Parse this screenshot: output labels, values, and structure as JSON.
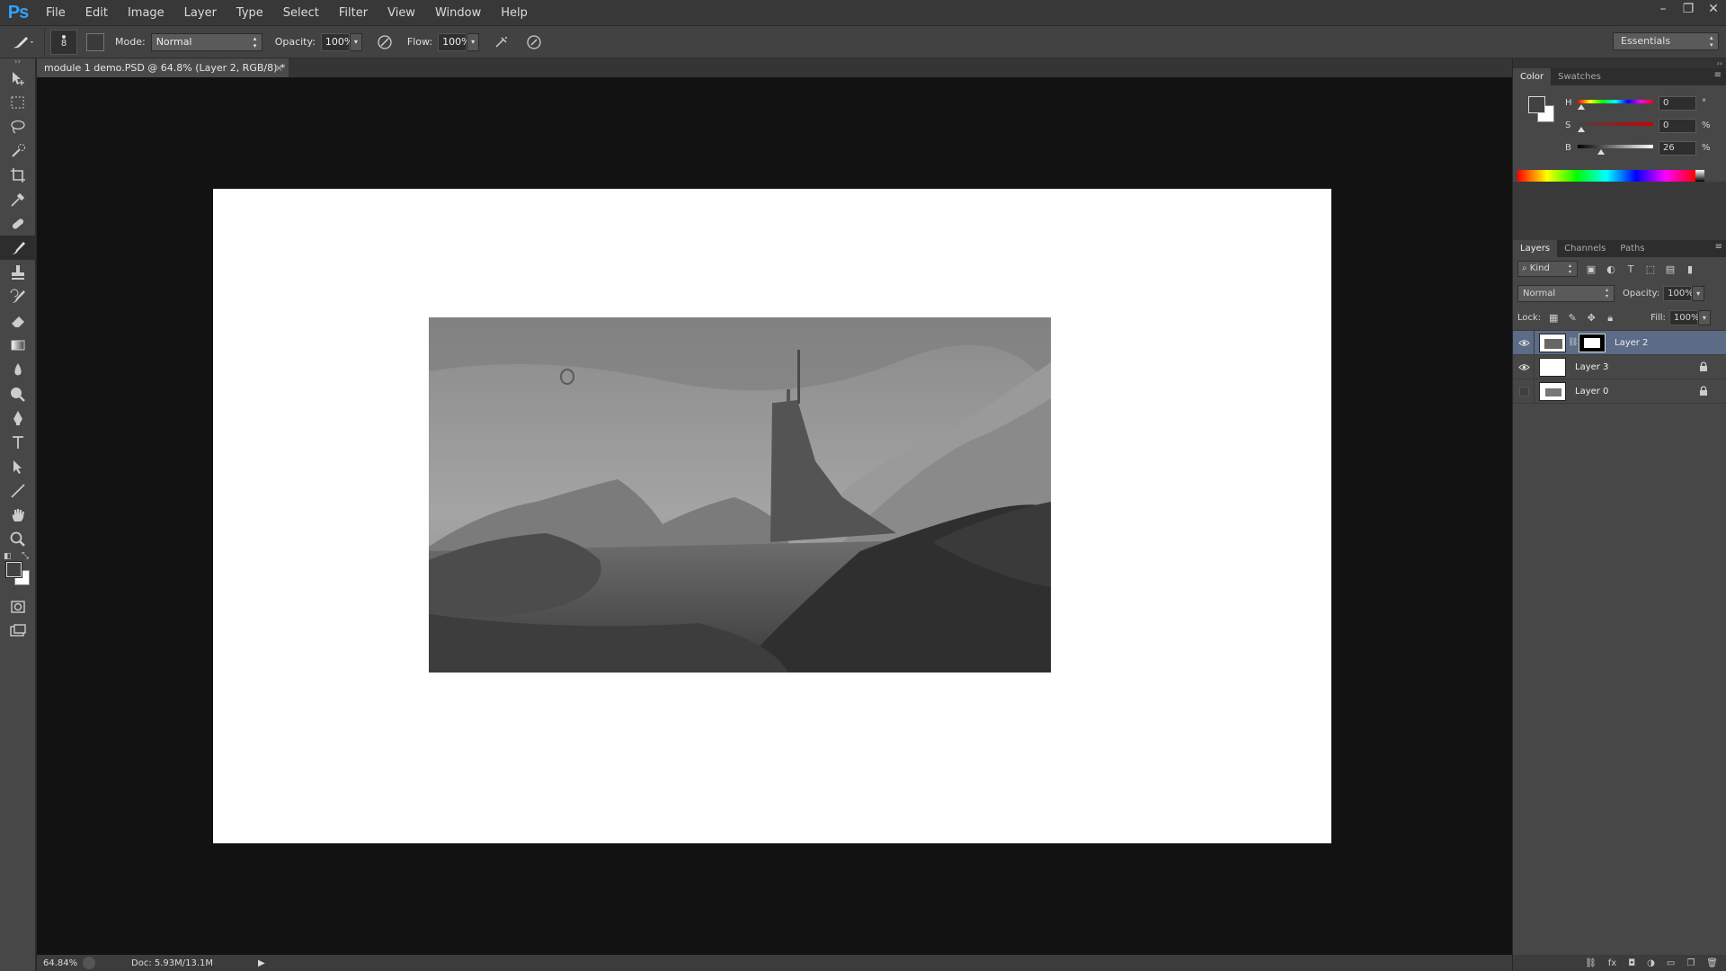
{
  "app": {
    "logo": "Ps"
  },
  "menu": [
    "File",
    "Edit",
    "Image",
    "Layer",
    "Type",
    "Select",
    "Filter",
    "View",
    "Window",
    "Help"
  ],
  "window_controls": {
    "minimize": "–",
    "restore": "❐",
    "close": "✕"
  },
  "options": {
    "brush_size": "8",
    "mode_label": "Mode:",
    "mode_value": "Normal",
    "opacity_label": "Opacity:",
    "opacity_value": "100%",
    "flow_label": "Flow:",
    "flow_value": "100%",
    "workspace": "Essentials"
  },
  "document": {
    "tab_title": "module 1 demo.PSD @ 64.8% (Layer 2, RGB/8) *",
    "close": "×"
  },
  "status": {
    "zoom": "64.84%",
    "doc_size": "Doc: 5.93M/13.1M",
    "arrow": "▶"
  },
  "color_panel": {
    "tabs": [
      "Color",
      "Swatches"
    ],
    "sliders": [
      {
        "label": "H",
        "value": "0",
        "unit": "°",
        "level": 0.0
      },
      {
        "label": "S",
        "value": "0",
        "unit": "%",
        "level": 0.0
      },
      {
        "label": "B",
        "value": "26",
        "unit": "%",
        "level": 0.26
      }
    ],
    "foreground": "#424242",
    "background": "#ffffff"
  },
  "layers_panel": {
    "tabs": [
      "Layers",
      "Channels",
      "Paths"
    ],
    "kind_label": "Kind",
    "blend_mode": "Normal",
    "opacity_label": "Opacity:",
    "opacity_value": "100%",
    "lock_label": "Lock:",
    "fill_label": "Fill:",
    "fill_value": "100%",
    "layers": [
      {
        "name": "Layer 2",
        "visible": true,
        "selected": true,
        "locked": false,
        "has_mask": true
      },
      {
        "name": "Layer 3",
        "visible": true,
        "selected": false,
        "locked": true,
        "has_mask": false
      },
      {
        "name": "Layer 0",
        "visible": false,
        "selected": false,
        "locked": true,
        "has_mask": false
      }
    ],
    "footer_icons": [
      "link-icon",
      "fx-icon",
      "mask-icon",
      "adjustment-icon",
      "folder-icon",
      "new-layer-icon",
      "trash-icon"
    ]
  },
  "colors": {
    "accent": "#2fa3ff",
    "selection": "#5c6b86",
    "canvas_bg": "#121212"
  }
}
